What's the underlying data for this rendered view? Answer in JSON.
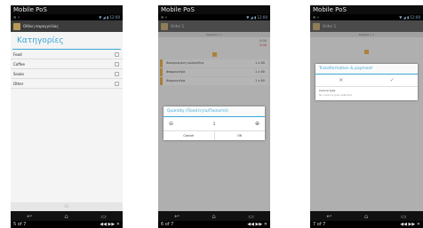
{
  "app_title": "Mobile PoS",
  "screens": [
    {
      "appbar_text": "Οθόνη παραγγελίας",
      "heading": "Κατηγορίες",
      "categories": [
        "Food",
        "Coffee",
        "Snaks",
        "Other"
      ],
      "ok_label": "OK",
      "footer_left": "5 of 7",
      "footer_right": "◀◀ ▶▶ ✕"
    },
    {
      "appbar_text": "Order 1",
      "subheader": "Καμάδα 1 1",
      "total_lines": [
        "0.00",
        "0.00"
      ],
      "lines": [
        {
          "name": "Φουρνισμένη κολοκύθια",
          "value": "1 x 80"
        },
        {
          "name": "Φορμαγιέρα",
          "value": "1 x 80"
        },
        {
          "name": "Φορμαγιέρα",
          "value": "1 x 80"
        }
      ],
      "dialog_title": "Quantity (Ποσότητα/Ποσοστό)",
      "dialog_value": "1",
      "cancel_label": "Cancel",
      "ok_label": "OK",
      "footer_left": "6 of 7",
      "footer_right": "◀◀ ▶▶ ✕"
    },
    {
      "appbar_text": "Order 1",
      "subheader": "Καμάδα 1 1",
      "dialog_title": "Transformation & payment",
      "field_label": "Invoice type",
      "field_placeholder": "No invoice type selected",
      "footer_left": "7 of 7",
      "footer_right": "◀◀ ▶▶ ✕"
    }
  ]
}
